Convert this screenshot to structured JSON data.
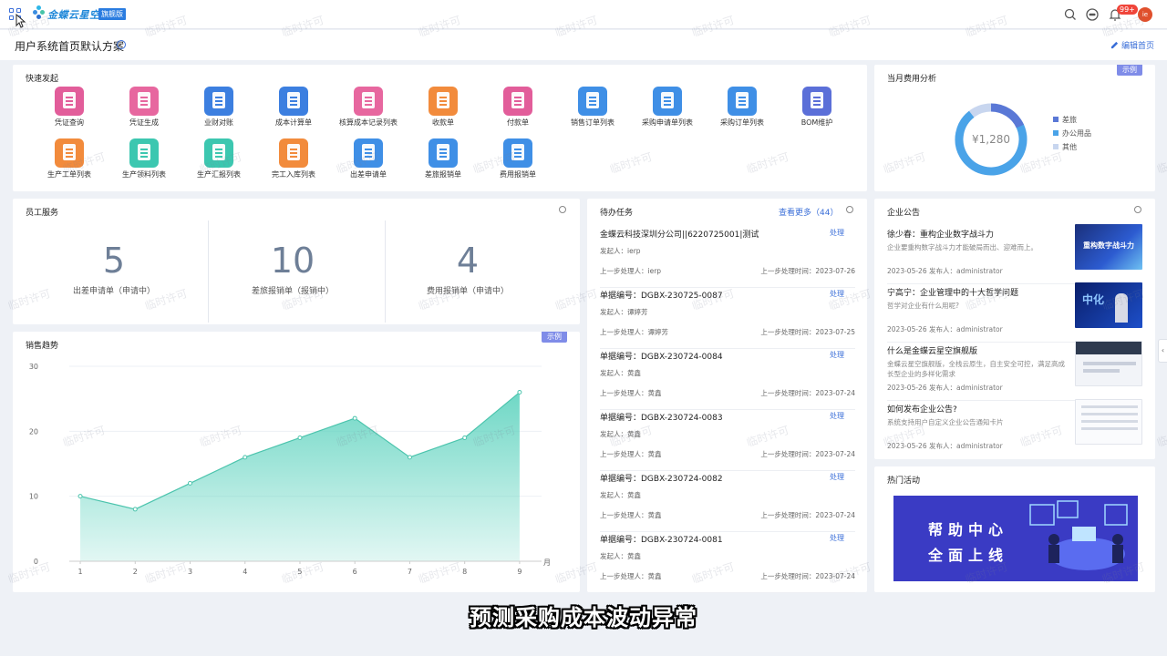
{
  "header": {
    "brand_name": "金蝶云星空",
    "brand_badge": "旗舰版",
    "notif_count": "99+",
    "avatar_text": "ie"
  },
  "subheader": {
    "page_title": "用户系统首页默认方案",
    "edit_label": "编辑首页"
  },
  "quick_launch": {
    "title": "快速发起",
    "items": [
      {
        "label": "凭证查询",
        "color": "#e25d9a"
      },
      {
        "label": "凭证生成",
        "color": "#e7679f"
      },
      {
        "label": "业财对账",
        "color": "#3c7fe0"
      },
      {
        "label": "成本计算单",
        "color": "#3c7fe0"
      },
      {
        "label": "核算成本记录列表",
        "color": "#e7679f"
      },
      {
        "label": "收款单",
        "color": "#f28b3c"
      },
      {
        "label": "付款单",
        "color": "#e25d9a"
      },
      {
        "label": "销售订单列表",
        "color": "#3f8fe6"
      },
      {
        "label": "采购申请单列表",
        "color": "#3f8fe6"
      },
      {
        "label": "采购订单列表",
        "color": "#3f8fe6"
      },
      {
        "label": "BOM维护",
        "color": "#5b6fd8"
      },
      {
        "label": "生产工单列表",
        "color": "#f28b3c"
      },
      {
        "label": "生产领料列表",
        "color": "#3cc7b0"
      },
      {
        "label": "生产汇报列表",
        "color": "#3cc7b0"
      },
      {
        "label": "完工入库列表",
        "color": "#f28b3c"
      },
      {
        "label": "出差申请单",
        "color": "#3f8fe6"
      },
      {
        "label": "差旅报销单",
        "color": "#3f8fe6"
      },
      {
        "label": "费用报销单",
        "color": "#3f8fe6"
      }
    ]
  },
  "expense": {
    "title": "当月费用分析",
    "sample_label": "示例",
    "center_value": "¥1,280",
    "legend": [
      {
        "label": "差旅",
        "color": "#5a78d6"
      },
      {
        "label": "办公用品",
        "color": "#4aa3e8"
      },
      {
        "label": "其他",
        "color": "#c8d6ef"
      }
    ]
  },
  "staff_service": {
    "title": "员工服务",
    "items": [
      {
        "value": "5",
        "label": "出差申请单（申请中）"
      },
      {
        "value": "10",
        "label": "差旅报销单（报销中）"
      },
      {
        "value": "4",
        "label": "费用报销单（申请中）"
      }
    ]
  },
  "todo": {
    "title": "待办任务",
    "more_label": "查看更多（44）",
    "items": [
      {
        "title": "金蝶云科技深圳分公司||6220725001|测试",
        "action": "处理",
        "initiator": "发起人：ierp",
        "prev": "上一步处理人：ierp",
        "time": "上一步处理时间：2023-07-26"
      },
      {
        "title": "单据编号：DGBX-230725-0087",
        "action": "处理",
        "initiator": "发起人：谭婷芳",
        "prev": "上一步处理人：谭婷芳",
        "time": "上一步处理时间：2023-07-25"
      },
      {
        "title": "单据编号：DGBX-230724-0084",
        "action": "处理",
        "initiator": "发起人：黄鑫",
        "prev": "上一步处理人：黄鑫",
        "time": "上一步处理时间：2023-07-24"
      },
      {
        "title": "单据编号：DGBX-230724-0083",
        "action": "处理",
        "initiator": "发起人：黄鑫",
        "prev": "上一步处理人：黄鑫",
        "time": "上一步处理时间：2023-07-24"
      },
      {
        "title": "单据编号：DGBX-230724-0082",
        "action": "处理",
        "initiator": "发起人：黄鑫",
        "prev": "上一步处理人：黄鑫",
        "time": "上一步处理时间：2023-07-24"
      },
      {
        "title": "单据编号：DGBX-230724-0081",
        "action": "处理",
        "initiator": "发起人：黄鑫",
        "prev": "上一步处理人：黄鑫",
        "time": "上一步处理时间：2023-07-24"
      }
    ]
  },
  "announcements": {
    "title": "企业公告",
    "items": [
      {
        "title": "徐少春：重构企业数字战斗力",
        "summary": "企业要重构数字战斗力才能破局而出、迎难而上。",
        "meta": "2023-05-26   发布人：administrator",
        "thumb_text": "重构数字战斗力"
      },
      {
        "title": "宁高宁：企业管理中的十大哲学问题",
        "summary": "哲学对企业有什么用呢?",
        "meta": "2023-05-26   发布人：administrator",
        "thumb_text": "中化"
      },
      {
        "title": "什么是金蝶云星空旗舰版",
        "summary": "金蝶云星空旗舰版，全栈云原生，自主安全可控，满足高成长型企业的多样化需求",
        "meta": "2023-05-26   发布人：administrator",
        "thumb_text": ""
      },
      {
        "title": "如何发布企业公告?",
        "summary": "系统支持用户自定义企业公告通知卡片",
        "meta": "2023-05-26   发布人：administrator",
        "thumb_text": ""
      }
    ]
  },
  "activity": {
    "title": "热门活动",
    "banner_line1": "帮助中心",
    "banner_line2": "全面上线"
  },
  "sales_trend": {
    "title": "销售趋势",
    "sample_label": "示例"
  },
  "chart_data": {
    "type": "area",
    "title": "销售趋势",
    "x": [
      1,
      2,
      3,
      4,
      5,
      6,
      7,
      8,
      9
    ],
    "values": [
      10,
      8,
      12,
      16,
      19,
      22,
      16,
      19,
      26
    ],
    "xlabel": "月",
    "ylabel": "",
    "ylim": [
      0,
      30
    ],
    "yticks": [
      0,
      10,
      20,
      30
    ],
    "color": "#5fd3bf"
  },
  "subtitle": "预测采购成本波动异常",
  "watermark": "临时许可"
}
